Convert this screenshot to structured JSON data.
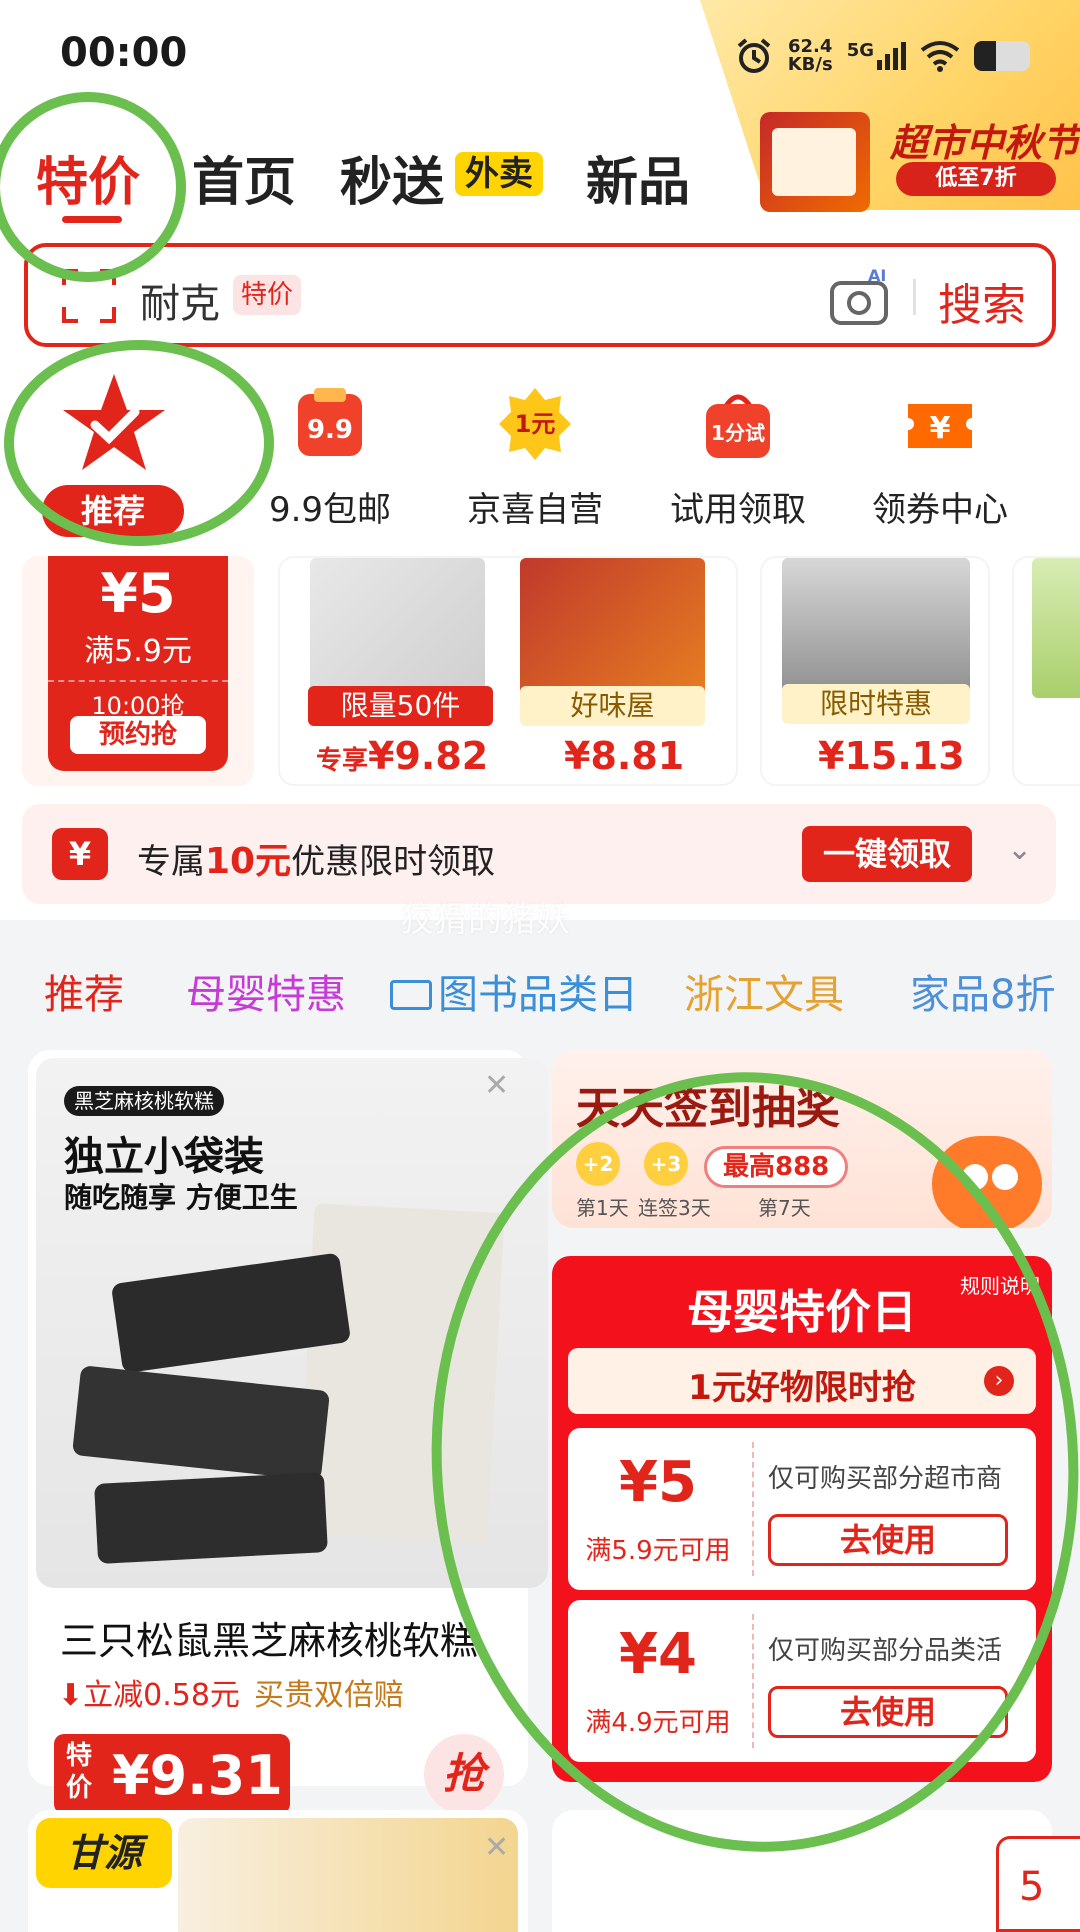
{
  "status_bar": {
    "time": "00:00",
    "net_speed_value": "62.4",
    "net_speed_unit": "KB/s",
    "network": "5G"
  },
  "nav": {
    "tabs": [
      {
        "label": "特价",
        "active": true
      },
      {
        "label": "首页"
      },
      {
        "label": "秒送"
      },
      {
        "label": "新品"
      }
    ],
    "waimai_tag": "外卖",
    "promo": {
      "title": "超市中秋节",
      "subtitle": "低至7折"
    }
  },
  "search": {
    "query": "耐克",
    "tag": "特价",
    "button": "搜索",
    "ai_label": "AI"
  },
  "categories": [
    {
      "label": "推荐",
      "icon": "star-check-icon",
      "active": true
    },
    {
      "label": "9.9包邮",
      "icon": "nine-nine-icon"
    },
    {
      "label": "京喜自营",
      "icon": "one-yuan-icon"
    },
    {
      "label": "试用领取",
      "icon": "trial-bag-icon"
    },
    {
      "label": "领券中心",
      "icon": "coupon-ticket-icon"
    }
  ],
  "coupon_card": {
    "amount": "¥5",
    "condition": "满5.9元",
    "time": "10:00抢",
    "button": "预约抢"
  },
  "strip_products": [
    {
      "tag": "限量50件",
      "price_prefix": "专享",
      "price": "¥9.82"
    },
    {
      "tag": "好味屋",
      "price": "¥8.81"
    },
    {
      "tag": "限时特惠",
      "price": "¥15.13"
    }
  ],
  "claim_banner": {
    "icon": "¥",
    "text_pre": "专属",
    "highlight": "10元",
    "text_post": "优惠限时领取",
    "button": "一键领取"
  },
  "watermark": "狡猾的猪妖",
  "channels": [
    {
      "label": "推荐",
      "color": "#e1251b"
    },
    {
      "label": "母婴特惠",
      "color": "#c63ad6"
    },
    {
      "label": "图书品类日",
      "color": "#3b8fd9"
    },
    {
      "label": "浙江文具",
      "color": "#e4a233"
    },
    {
      "label": "家品8折",
      "color": "#4e90d8"
    }
  ],
  "feed_product": {
    "photo_badge": "黑芝麻核桃软糕",
    "photo_headline": "独立小袋装",
    "photo_sub": "随吃随享 方便卫生",
    "title": "三只松鼠黑芝麻核桃软糕",
    "saving": "立减0.58元",
    "guarantee": "买贵双倍赔",
    "price_tag": "特价",
    "price": "¥9.31",
    "grab": "抢"
  },
  "sign_in": {
    "title": "天天签到抽奖",
    "day1_reward": "+2",
    "day3_reward": "+3",
    "max_reward": "最高888",
    "days": [
      "第1天",
      "连签3天",
      "第7天"
    ]
  },
  "baby_deal": {
    "title": "母婴特价日",
    "rules": "规则说明",
    "band": "1元好物限时抢",
    "coupons": [
      {
        "amount": "¥5",
        "condition": "满5.9元可用",
        "note": "仅可购买部分超市商",
        "button": "去使用"
      },
      {
        "amount": "¥4",
        "condition": "满4.9元可用",
        "note": "仅可购买部分品类活",
        "button": "去使用"
      }
    ]
  },
  "next_row": {
    "brand": "甘源",
    "float_badge": "5"
  },
  "colors": {
    "brand_red": "#e1251b",
    "annotation_green": "#6bbf4e"
  }
}
